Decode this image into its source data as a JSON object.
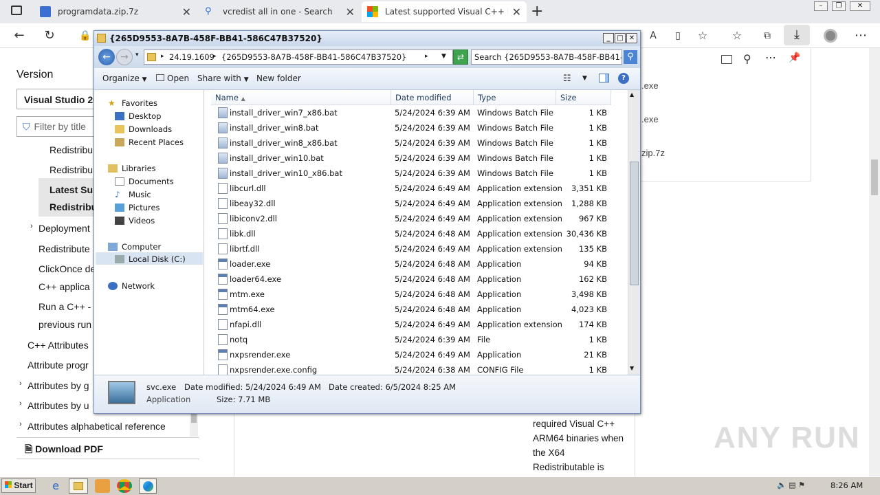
{
  "browser": {
    "tabs": [
      {
        "title": "programdata.zip.7z",
        "icon": "download-shield-icon"
      },
      {
        "title": "vcredist all in one - Search",
        "icon": "search-icon"
      },
      {
        "title": "Latest supported Visual C++ Red",
        "icon": "microsoft-logo-icon"
      }
    ],
    "new_tab_label": "+"
  },
  "downloads_panel": {
    "items": [
      ".exe",
      ".exe",
      "zip.7z"
    ]
  },
  "page": {
    "section_title": "Version",
    "version_select": "Visual Studio 20",
    "filter_placeholder": "Filter by title",
    "nav": [
      "Redistribu",
      "Redistribu",
      "Latest Sup",
      "Redistribu",
      "Deployment",
      "Redistribute",
      "ClickOnce de",
      "C++ applica",
      "Run a C++ -",
      "previous run",
      "C++ Attributes",
      "Attribute progr",
      "Attributes by g",
      "Attributes by u",
      "Attributes alphabetical reference"
    ],
    "download_pdf": "Download PDF",
    "body_text": [
      "required Visual C++",
      "ARM64 binaries when",
      "the X64",
      "Redistributable is"
    ],
    "watermark": "ANY RUN"
  },
  "explorer": {
    "title": "{265D9553-8A7B-458F-BB41-586C47B37520}",
    "path": [
      "24.19.1609",
      "{265D9553-8A7B-458F-BB41-586C47B37520}"
    ],
    "search_placeholder": "Search {265D9553-8A7B-458F-BB41-5...",
    "commands": {
      "organize": "Organize",
      "open": "Open",
      "share": "Share with",
      "new_folder": "New folder"
    },
    "nav": {
      "favorites": "Favorites",
      "desktop": "Desktop",
      "downloads": "Downloads",
      "recent": "Recent Places",
      "libraries": "Libraries",
      "documents": "Documents",
      "music": "Music",
      "pictures": "Pictures",
      "videos": "Videos",
      "computer": "Computer",
      "local_disk": "Local Disk (C:)",
      "network": "Network"
    },
    "columns": {
      "name": "Name",
      "date": "Date modified",
      "type": "Type",
      "size": "Size"
    },
    "files": [
      {
        "name": "install_driver_win7_x86.bat",
        "date": "5/24/2024 6:39 AM",
        "type": "Windows Batch File",
        "size": "1 KB"
      },
      {
        "name": "install_driver_win8.bat",
        "date": "5/24/2024 6:39 AM",
        "type": "Windows Batch File",
        "size": "1 KB"
      },
      {
        "name": "install_driver_win8_x86.bat",
        "date": "5/24/2024 6:39 AM",
        "type": "Windows Batch File",
        "size": "1 KB"
      },
      {
        "name": "install_driver_win10.bat",
        "date": "5/24/2024 6:39 AM",
        "type": "Windows Batch File",
        "size": "1 KB"
      },
      {
        "name": "install_driver_win10_x86.bat",
        "date": "5/24/2024 6:39 AM",
        "type": "Windows Batch File",
        "size": "1 KB"
      },
      {
        "name": "libcurl.dll",
        "date": "5/24/2024 6:49 AM",
        "type": "Application extension",
        "size": "3,351 KB"
      },
      {
        "name": "libeay32.dll",
        "date": "5/24/2024 6:49 AM",
        "type": "Application extension",
        "size": "1,288 KB"
      },
      {
        "name": "libiconv2.dll",
        "date": "5/24/2024 6:49 AM",
        "type": "Application extension",
        "size": "967 KB"
      },
      {
        "name": "libk.dll",
        "date": "5/24/2024 6:48 AM",
        "type": "Application extension",
        "size": "30,436 KB"
      },
      {
        "name": "librtf.dll",
        "date": "5/24/2024 6:49 AM",
        "type": "Application extension",
        "size": "135 KB"
      },
      {
        "name": "loader.exe",
        "date": "5/24/2024 6:48 AM",
        "type": "Application",
        "size": "94 KB"
      },
      {
        "name": "loader64.exe",
        "date": "5/24/2024 6:48 AM",
        "type": "Application",
        "size": "162 KB"
      },
      {
        "name": "mtm.exe",
        "date": "5/24/2024 6:48 AM",
        "type": "Application",
        "size": "3,498 KB"
      },
      {
        "name": "mtm64.exe",
        "date": "5/24/2024 6:48 AM",
        "type": "Application",
        "size": "4,023 KB"
      },
      {
        "name": "nfapi.dll",
        "date": "5/24/2024 6:49 AM",
        "type": "Application extension",
        "size": "174 KB"
      },
      {
        "name": "notq",
        "date": "5/24/2024 6:39 AM",
        "type": "File",
        "size": "1 KB"
      },
      {
        "name": "nxpsrender.exe",
        "date": "5/24/2024 6:49 AM",
        "type": "Application",
        "size": "21 KB"
      },
      {
        "name": "nxpsrender.exe.config",
        "date": "5/24/2024 6:38 AM",
        "type": "CONFIG File",
        "size": "1 KB"
      }
    ],
    "details": {
      "name": "svc.exe",
      "kind": "Application",
      "modified": "Date modified: 5/24/2024 6:49 AM",
      "size": "Size: 7.71 MB",
      "created": "Date created: 6/5/2024 8:25 AM"
    }
  },
  "taskbar": {
    "start": "Start",
    "clock": "8:26 AM"
  }
}
